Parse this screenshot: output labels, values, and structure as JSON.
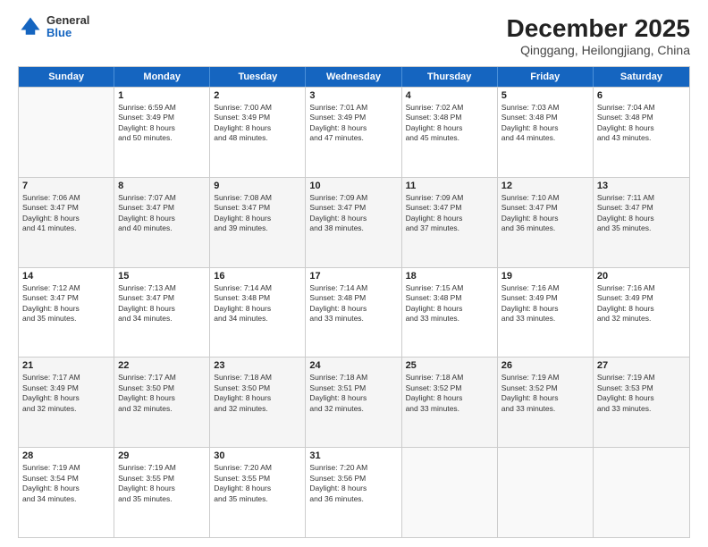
{
  "logo": {
    "general": "General",
    "blue": "Blue"
  },
  "header": {
    "title": "December 2025",
    "subtitle": "Qinggang, Heilongjiang, China"
  },
  "days_of_week": [
    "Sunday",
    "Monday",
    "Tuesday",
    "Wednesday",
    "Thursday",
    "Friday",
    "Saturday"
  ],
  "weeks": [
    [
      {
        "day": "",
        "info": ""
      },
      {
        "day": "1",
        "info": "Sunrise: 6:59 AM\nSunset: 3:49 PM\nDaylight: 8 hours\nand 50 minutes."
      },
      {
        "day": "2",
        "info": "Sunrise: 7:00 AM\nSunset: 3:49 PM\nDaylight: 8 hours\nand 48 minutes."
      },
      {
        "day": "3",
        "info": "Sunrise: 7:01 AM\nSunset: 3:49 PM\nDaylight: 8 hours\nand 47 minutes."
      },
      {
        "day": "4",
        "info": "Sunrise: 7:02 AM\nSunset: 3:48 PM\nDaylight: 8 hours\nand 45 minutes."
      },
      {
        "day": "5",
        "info": "Sunrise: 7:03 AM\nSunset: 3:48 PM\nDaylight: 8 hours\nand 44 minutes."
      },
      {
        "day": "6",
        "info": "Sunrise: 7:04 AM\nSunset: 3:48 PM\nDaylight: 8 hours\nand 43 minutes."
      }
    ],
    [
      {
        "day": "7",
        "info": "Sunrise: 7:06 AM\nSunset: 3:47 PM\nDaylight: 8 hours\nand 41 minutes."
      },
      {
        "day": "8",
        "info": "Sunrise: 7:07 AM\nSunset: 3:47 PM\nDaylight: 8 hours\nand 40 minutes."
      },
      {
        "day": "9",
        "info": "Sunrise: 7:08 AM\nSunset: 3:47 PM\nDaylight: 8 hours\nand 39 minutes."
      },
      {
        "day": "10",
        "info": "Sunrise: 7:09 AM\nSunset: 3:47 PM\nDaylight: 8 hours\nand 38 minutes."
      },
      {
        "day": "11",
        "info": "Sunrise: 7:09 AM\nSunset: 3:47 PM\nDaylight: 8 hours\nand 37 minutes."
      },
      {
        "day": "12",
        "info": "Sunrise: 7:10 AM\nSunset: 3:47 PM\nDaylight: 8 hours\nand 36 minutes."
      },
      {
        "day": "13",
        "info": "Sunrise: 7:11 AM\nSunset: 3:47 PM\nDaylight: 8 hours\nand 35 minutes."
      }
    ],
    [
      {
        "day": "14",
        "info": "Sunrise: 7:12 AM\nSunset: 3:47 PM\nDaylight: 8 hours\nand 35 minutes."
      },
      {
        "day": "15",
        "info": "Sunrise: 7:13 AM\nSunset: 3:47 PM\nDaylight: 8 hours\nand 34 minutes."
      },
      {
        "day": "16",
        "info": "Sunrise: 7:14 AM\nSunset: 3:48 PM\nDaylight: 8 hours\nand 34 minutes."
      },
      {
        "day": "17",
        "info": "Sunrise: 7:14 AM\nSunset: 3:48 PM\nDaylight: 8 hours\nand 33 minutes."
      },
      {
        "day": "18",
        "info": "Sunrise: 7:15 AM\nSunset: 3:48 PM\nDaylight: 8 hours\nand 33 minutes."
      },
      {
        "day": "19",
        "info": "Sunrise: 7:16 AM\nSunset: 3:49 PM\nDaylight: 8 hours\nand 33 minutes."
      },
      {
        "day": "20",
        "info": "Sunrise: 7:16 AM\nSunset: 3:49 PM\nDaylight: 8 hours\nand 32 minutes."
      }
    ],
    [
      {
        "day": "21",
        "info": "Sunrise: 7:17 AM\nSunset: 3:49 PM\nDaylight: 8 hours\nand 32 minutes."
      },
      {
        "day": "22",
        "info": "Sunrise: 7:17 AM\nSunset: 3:50 PM\nDaylight: 8 hours\nand 32 minutes."
      },
      {
        "day": "23",
        "info": "Sunrise: 7:18 AM\nSunset: 3:50 PM\nDaylight: 8 hours\nand 32 minutes."
      },
      {
        "day": "24",
        "info": "Sunrise: 7:18 AM\nSunset: 3:51 PM\nDaylight: 8 hours\nand 32 minutes."
      },
      {
        "day": "25",
        "info": "Sunrise: 7:18 AM\nSunset: 3:52 PM\nDaylight: 8 hours\nand 33 minutes."
      },
      {
        "day": "26",
        "info": "Sunrise: 7:19 AM\nSunset: 3:52 PM\nDaylight: 8 hours\nand 33 minutes."
      },
      {
        "day": "27",
        "info": "Sunrise: 7:19 AM\nSunset: 3:53 PM\nDaylight: 8 hours\nand 33 minutes."
      }
    ],
    [
      {
        "day": "28",
        "info": "Sunrise: 7:19 AM\nSunset: 3:54 PM\nDaylight: 8 hours\nand 34 minutes."
      },
      {
        "day": "29",
        "info": "Sunrise: 7:19 AM\nSunset: 3:55 PM\nDaylight: 8 hours\nand 35 minutes."
      },
      {
        "day": "30",
        "info": "Sunrise: 7:20 AM\nSunset: 3:55 PM\nDaylight: 8 hours\nand 35 minutes."
      },
      {
        "day": "31",
        "info": "Sunrise: 7:20 AM\nSunset: 3:56 PM\nDaylight: 8 hours\nand 36 minutes."
      },
      {
        "day": "",
        "info": ""
      },
      {
        "day": "",
        "info": ""
      },
      {
        "day": "",
        "info": ""
      }
    ]
  ]
}
